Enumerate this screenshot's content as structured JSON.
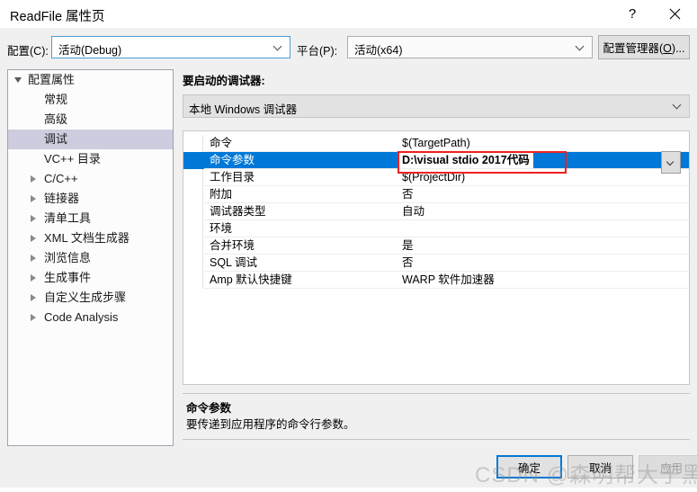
{
  "window": {
    "title": "ReadFile 属性页",
    "help_button": "?",
    "close_button": "close-icon"
  },
  "toolbar": {
    "config_label": "配置(C):",
    "config_value": "活动(Debug)",
    "platform_label": "平台(P):",
    "platform_value": "活动(x64)",
    "config_manager_button": "配置管理器(O)...",
    "config_manager_accel": "O"
  },
  "tree": {
    "items": [
      {
        "label": "配置属性",
        "indent": 22,
        "marker": "open",
        "selected": false
      },
      {
        "label": "常规",
        "indent": 40,
        "marker": "none",
        "selected": false
      },
      {
        "label": "高级",
        "indent": 40,
        "marker": "none",
        "selected": false
      },
      {
        "label": "调试",
        "indent": 40,
        "marker": "none",
        "selected": true
      },
      {
        "label": "VC++ 目录",
        "indent": 40,
        "marker": "none",
        "selected": false
      },
      {
        "label": "C/C++",
        "indent": 40,
        "marker": "closed",
        "selected": false
      },
      {
        "label": "链接器",
        "indent": 40,
        "marker": "closed",
        "selected": false
      },
      {
        "label": "清单工具",
        "indent": 40,
        "marker": "closed",
        "selected": false
      },
      {
        "label": "XML 文档生成器",
        "indent": 40,
        "marker": "closed",
        "selected": false
      },
      {
        "label": "浏览信息",
        "indent": 40,
        "marker": "closed",
        "selected": false
      },
      {
        "label": "生成事件",
        "indent": 40,
        "marker": "closed",
        "selected": false
      },
      {
        "label": "自定义生成步骤",
        "indent": 40,
        "marker": "closed",
        "selected": false
      },
      {
        "label": "Code Analysis",
        "indent": 40,
        "marker": "closed",
        "selected": false
      }
    ]
  },
  "main": {
    "debugger_label": "要启动的调试器:",
    "debugger_value": "本地 Windows 调试器",
    "properties": [
      {
        "name": "命令",
        "value": "$(TargetPath)",
        "selected": false
      },
      {
        "name": "命令参数",
        "value": "D:\\visual stdio 2017代码",
        "selected": true
      },
      {
        "name": "工作目录",
        "value": "$(ProjectDir)",
        "selected": false
      },
      {
        "name": "附加",
        "value": "否",
        "selected": false
      },
      {
        "name": "调试器类型",
        "value": "自动",
        "selected": false
      },
      {
        "name": "环境",
        "value": "",
        "selected": false
      },
      {
        "name": "合并环境",
        "value": "是",
        "selected": false
      },
      {
        "name": "SQL 调试",
        "value": "否",
        "selected": false
      },
      {
        "name": "Amp 默认快捷键",
        "value": "WARP 软件加速器",
        "selected": false
      }
    ],
    "highlight_color": "#f02020"
  },
  "description": {
    "title": "命令参数",
    "body": "要传递到应用程序的命令行参数。"
  },
  "footer": {
    "ok": "确定",
    "cancel": "取消",
    "apply": "应用"
  },
  "watermark": "CSDN @森明帮大于黑虎帮"
}
